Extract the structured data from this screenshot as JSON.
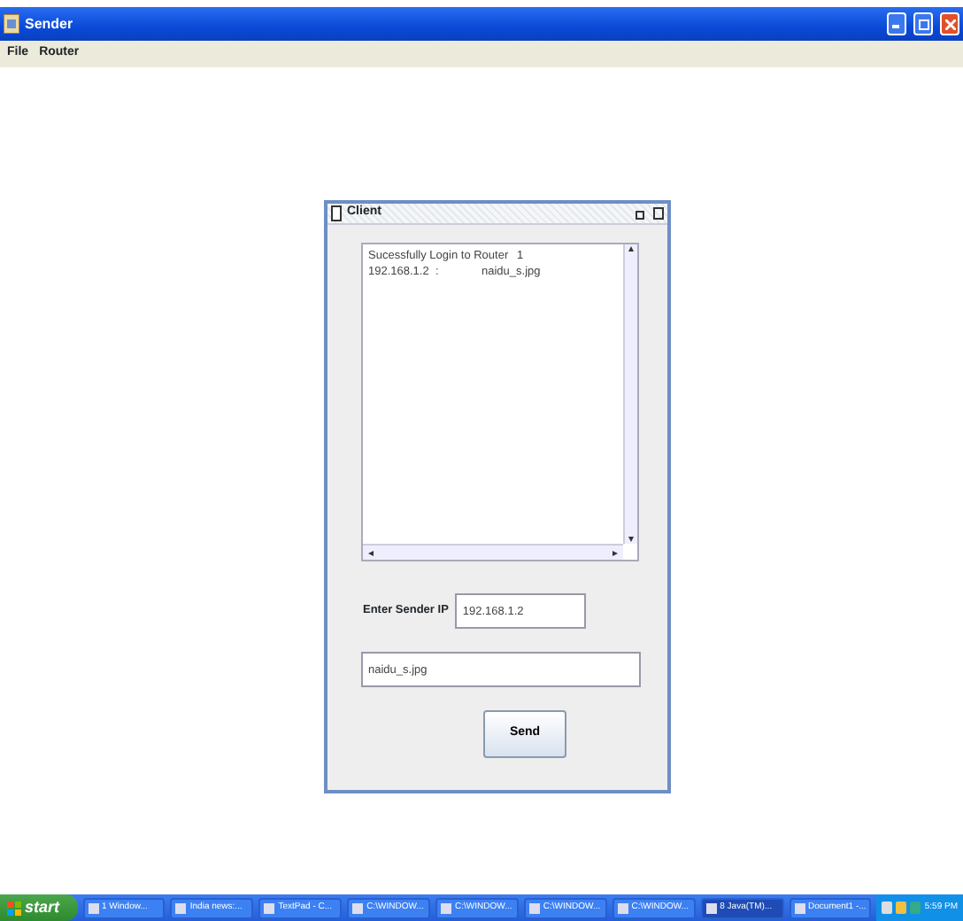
{
  "window": {
    "title": "Sender"
  },
  "menu": [
    "File",
    "Router"
  ],
  "client": {
    "title": "Client",
    "log": [
      [
        "Sucessfully Login to Router",
        "1"
      ],
      [
        "192.168.1.2",
        ":",
        "naidu_s.jpg"
      ]
    ],
    "ip_label": "Enter Sender IP",
    "ip_value": "192.168.1.2",
    "file_value": "naidu_s.jpg",
    "send": "Send"
  },
  "taskbar": {
    "start": "start",
    "items": [
      {
        "label": "1 Window...",
        "selected": false
      },
      {
        "label": "India news:...",
        "selected": false
      },
      {
        "label": "TextPad - C...",
        "selected": false
      },
      {
        "label": "C:\\WINDOW...",
        "selected": false
      },
      {
        "label": "C:\\WINDOW...",
        "selected": false
      },
      {
        "label": "C:\\WINDOW...",
        "selected": false
      },
      {
        "label": "C:\\WINDOW...",
        "selected": false
      },
      {
        "label": "8 Java(TM)...",
        "selected": true
      },
      {
        "label": "Document1 -...",
        "selected": false
      }
    ],
    "clock": "5:59 PM"
  }
}
